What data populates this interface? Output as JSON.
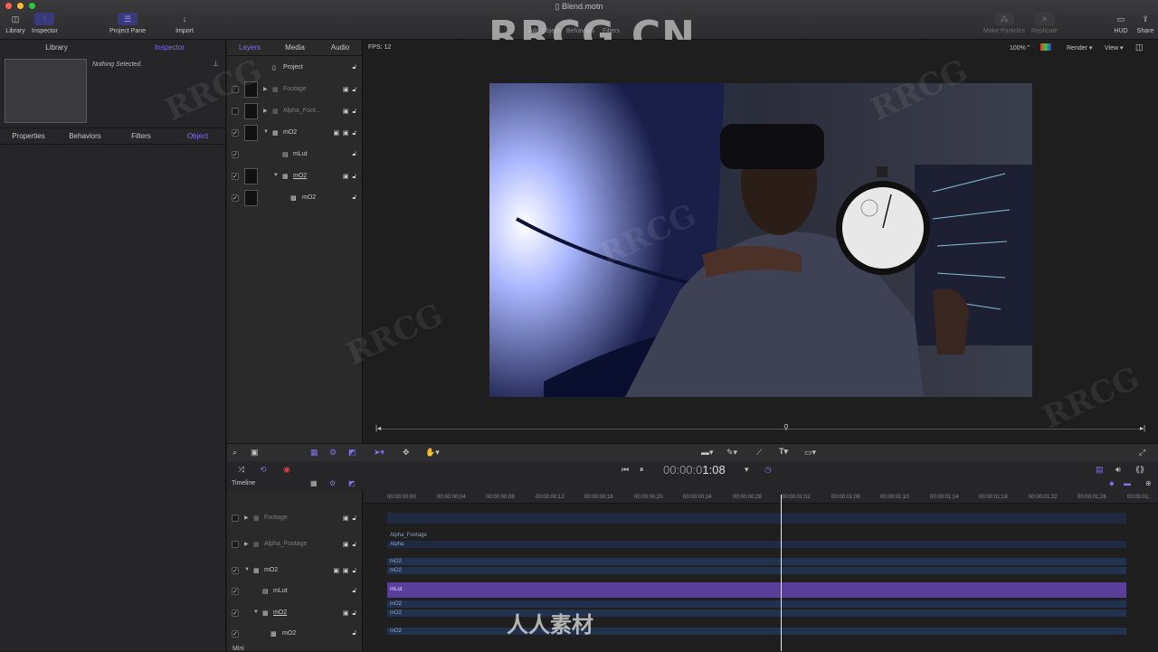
{
  "window": {
    "title": "Blend.motn",
    "watermark": "RRCG.CN"
  },
  "toolbar": {
    "library_label": "Library",
    "inspector_label": "Inspector",
    "project_pane_label": "Project Pane",
    "import_label": "Import",
    "add_object_label": "Add Object",
    "behaviors_label": "Behaviors",
    "filters_label": "Filters",
    "make_particles_label": "Make Particles",
    "replicate_label": "Replicate",
    "hud_label": "HUD",
    "share_label": "Share"
  },
  "left_panel": {
    "tabs": [
      "Library",
      "Inspector"
    ],
    "active_tab": "Inspector",
    "nothing_selected": "Nothing Selected.",
    "inspector_tabs": [
      "Properties",
      "Behaviors",
      "Filters",
      "Object"
    ],
    "active_inspector_tab": "Object"
  },
  "layers_panel": {
    "tabs": [
      "Layers",
      "Media",
      "Audio"
    ],
    "active_tab": "Layers",
    "project_label": "Project",
    "rows": [
      {
        "name": "Footage",
        "checked": false
      },
      {
        "name": "Alpha_Foot...",
        "checked": false
      },
      {
        "name": "mO2",
        "checked": true
      },
      {
        "name": "mLut",
        "checked": true
      },
      {
        "name": "mO2",
        "checked": true
      },
      {
        "name": "mO2",
        "checked": true
      }
    ]
  },
  "viewer": {
    "fps": "FPS: 12",
    "zoom": "100%",
    "render_label": "Render",
    "view_label": "View"
  },
  "transport": {
    "timecode_dim": "00:00:0",
    "timecode_bright": "1:08"
  },
  "timeline": {
    "label": "Timeline",
    "ruler": [
      "00:00:00;00",
      "00:00:00;04",
      "00:00:00;08",
      "00:00:00;12",
      "00:00:00;16",
      "00:00:00;20",
      "00:00:00;24",
      "00:00:00;28",
      "00:00:01;02",
      "00:00:01;06",
      "00:00:01;10",
      "00:00:01;14",
      "00:00:01;18",
      "00:00:01;22",
      "00:00:01;26",
      "00:00:01;"
    ],
    "layer_rows": [
      {
        "name": "Footage",
        "checked": false
      },
      {
        "name": "Alpha_Footage",
        "checked": false
      },
      {
        "name": "mO2",
        "checked": true
      },
      {
        "name": "mLut",
        "checked": true
      },
      {
        "name": "mO2",
        "checked": true
      },
      {
        "name": "mO2",
        "checked": true
      }
    ],
    "bars": {
      "alpha_footage": "Alpha_Footage",
      "alpha": "Alpha",
      "mo2_a": "mO2",
      "mo2_b": "mO2",
      "mlut": "mLut",
      "mo2_c": "mO2",
      "mo2_d": "mO2",
      "mo2_e": "mO2"
    },
    "mini_label": "Mini"
  },
  "brand": {
    "cn_text": "人人素材"
  }
}
